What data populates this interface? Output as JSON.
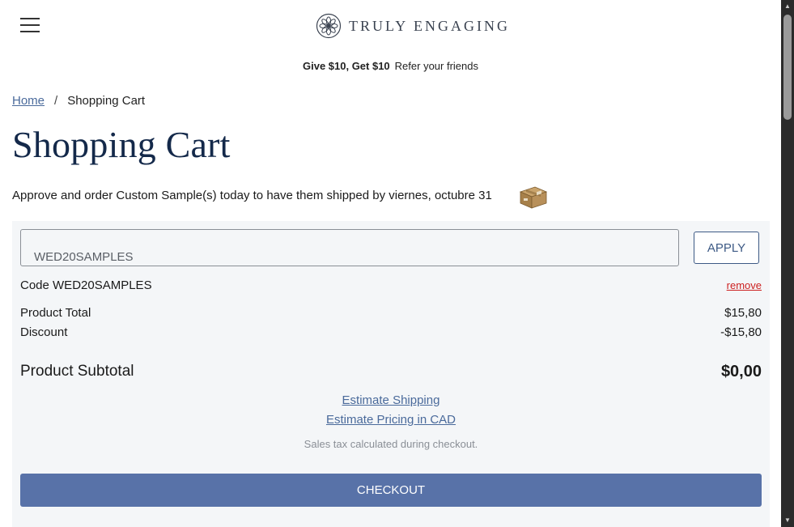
{
  "header": {
    "brand": "TRULY ENGAGING",
    "promo_bold": "Give $10, Get $10",
    "promo_link": "Refer your friends"
  },
  "breadcrumb": {
    "home": "Home",
    "separator": "/",
    "current": "Shopping Cart"
  },
  "page_title": "Shopping Cart",
  "ship_note": "Approve and order Custom Sample(s) today to have them shipped by viernes, octubre 31",
  "coupon": {
    "input_value": "WED20SAMPLES",
    "apply_label": "APPLY",
    "applied_label": "Code WED20SAMPLES",
    "remove_label": "remove"
  },
  "totals": {
    "product_total_label": "Product Total",
    "product_total_value": "$15,80",
    "discount_label": "Discount",
    "discount_value": "-$15,80",
    "subtotal_label": "Product Subtotal",
    "subtotal_value": "$0,00"
  },
  "links": {
    "estimate_shipping": "Estimate Shipping",
    "estimate_pricing": "Estimate Pricing in CAD"
  },
  "tax_note": "Sales tax calculated during checkout.",
  "checkout_label": "CHECKOUT",
  "colors": {
    "brand_navy": "#14294a",
    "link_blue": "#4a6a9b",
    "checkout_blue": "#5872a8",
    "remove_red": "#cc1f1f",
    "panel_bg": "#f4f6f8"
  },
  "icons": [
    "hamburger-menu-icon",
    "logo-flower-icon",
    "shipping-box-icon"
  ]
}
